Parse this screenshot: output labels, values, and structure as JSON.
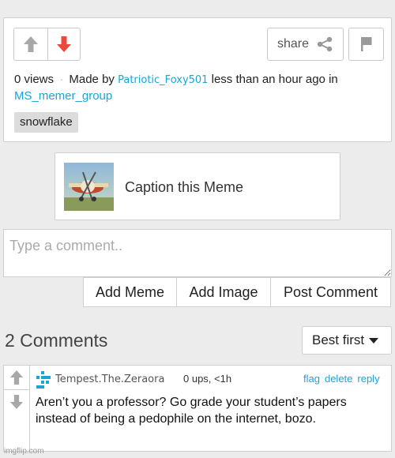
{
  "post": {
    "share_label": "share",
    "views": "0 views",
    "separator": "·",
    "made_by_prefix": "Made by",
    "author": "Patriotic_Foxy501",
    "time_text": "less than an hour ago in",
    "group": "MS_memer_group",
    "tag": "snowflake",
    "upvote_icon": "arrow-up-icon",
    "downvote_icon": "arrow-down-icon",
    "downvote_color": "#e94a3a",
    "flag_icon": "flag-icon",
    "share_icon": "share-icon"
  },
  "caption": {
    "label": "Caption this Meme"
  },
  "comment_box": {
    "placeholder": "Type a comment.."
  },
  "actions": {
    "add_meme": "Add Meme",
    "add_image": "Add Image",
    "post_comment": "Post Comment"
  },
  "comments": {
    "count_label": "2 Comments",
    "sort_label": "Best first",
    "items": [
      {
        "user": "Tempest.The.Zeraora",
        "meta": "0 ups, <1h",
        "flag": "flag",
        "delete": "delete",
        "reply": "reply",
        "text": "Aren’t you a professor? Go grade your student’s papers instead of being a pedophile on the internet, bozo.",
        "avatar_color": "#1aa4d8"
      }
    ]
  },
  "watermark": "imgflip.com",
  "colors": {
    "link": "#1aa4d8",
    "border": "#cfcfcf",
    "background": "#ececec"
  }
}
